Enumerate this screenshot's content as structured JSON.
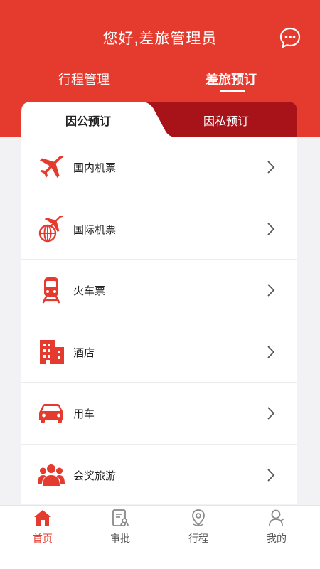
{
  "header": {
    "title": "您好,差旅管理员",
    "message_icon": "chat-bubble-icon",
    "tabs": [
      {
        "label": "行程管理",
        "active": false
      },
      {
        "label": "差旅预订",
        "active": true
      }
    ]
  },
  "segments": [
    {
      "label": "因公预订",
      "active": true
    },
    {
      "label": "因私预订",
      "active": false
    }
  ],
  "services": [
    {
      "label": "国内机票",
      "icon": "airplane-icon"
    },
    {
      "label": "国际机票",
      "icon": "globe-plane-icon"
    },
    {
      "label": "火车票",
      "icon": "train-icon"
    },
    {
      "label": "酒店",
      "icon": "hotel-icon"
    },
    {
      "label": "用车",
      "icon": "car-icon"
    },
    {
      "label": "会奖旅游",
      "icon": "group-icon"
    }
  ],
  "bottom_nav": [
    {
      "label": "首页",
      "icon": "home-icon",
      "active": true
    },
    {
      "label": "审批",
      "icon": "approval-icon",
      "active": false
    },
    {
      "label": "行程",
      "icon": "location-pin-icon",
      "active": false
    },
    {
      "label": "我的",
      "icon": "user-icon",
      "active": false
    }
  ],
  "colors": {
    "accent": "#e53a2e",
    "accent_dark": "#a8131a",
    "background": "#f2f2f4"
  }
}
